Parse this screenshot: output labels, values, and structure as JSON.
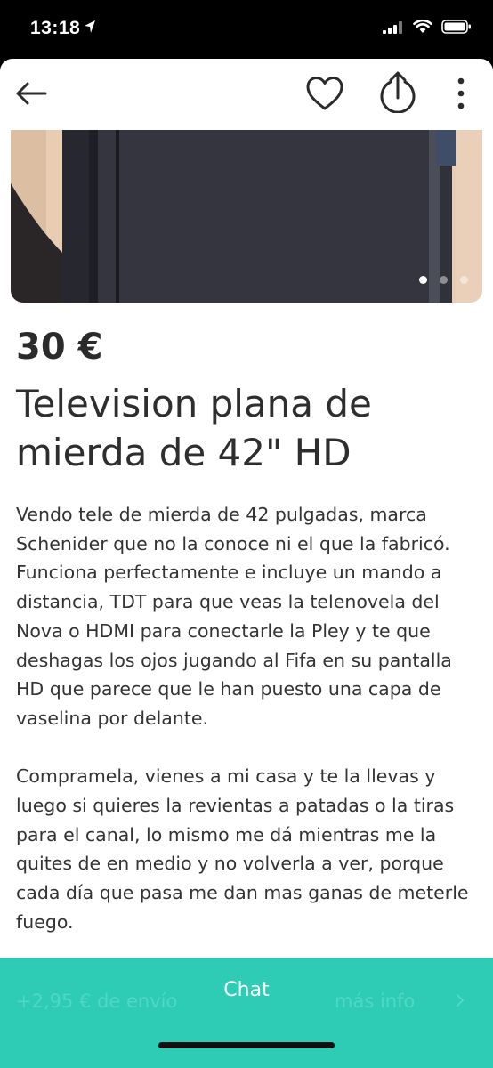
{
  "status_bar": {
    "time": "13:18"
  },
  "product": {
    "price": "30 €",
    "title": "Television plana de mierda de 42\" HD",
    "description": "Vendo tele de mierda de 42 pulgadas, marca Schenider que no la conoce ni el que la fabricó. Funciona perfectamente e incluye un mando a distancia,  TDT para que veas la telenovela del Nova o HDMI para conectarle la Pley y te que deshagas los ojos jugando al Fifa en su pantalla HD que parece que le han puesto una capa de vaselina por delante.\n\nCompramela, vienes a mi casa y te la llevas y luego si quieres la revientas a patadas o la tiras para el canal, lo mismo me dá mientras me la quites de en medio y no volverla a ver, porque cada día que pasa me dan mas ganas de meterle fuego.",
    "image_count": 3,
    "image_index": 1
  },
  "bottom_bar": {
    "shipping": "+2,95 € de envío",
    "chat_label": "Chat",
    "more_info": "más info"
  },
  "icons": [
    "back-arrow-icon",
    "heart-icon",
    "share-icon",
    "more-vert-icon",
    "location-arrow-icon",
    "signal-icon",
    "wifi-icon",
    "battery-icon",
    "chevron-right-icon"
  ],
  "colors": {
    "accent": "#2ecbb5",
    "text": "#333333"
  }
}
